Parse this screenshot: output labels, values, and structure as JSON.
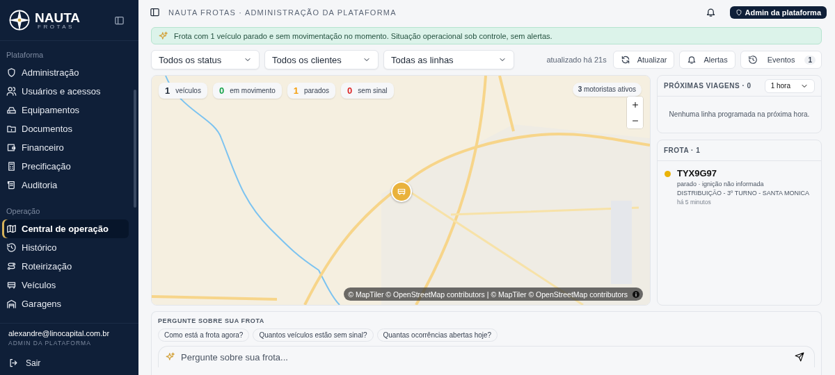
{
  "brand": {
    "name": "NAUTA",
    "sub": "FROTAS"
  },
  "sidebar": {
    "sections": [
      {
        "title": "Plataforma",
        "items": [
          {
            "label": "Administração",
            "selected": false
          },
          {
            "label": "Usuários e acessos",
            "selected": false
          },
          {
            "label": "Equipamentos",
            "selected": false
          },
          {
            "label": "Documentos",
            "selected": false
          },
          {
            "label": "Financeiro",
            "selected": false
          },
          {
            "label": "Precificação",
            "selected": false
          },
          {
            "label": "Auditoria",
            "selected": false
          }
        ]
      },
      {
        "title": "Operação",
        "items": [
          {
            "label": "Central de operação",
            "selected": true
          },
          {
            "label": "Histórico",
            "selected": false
          },
          {
            "label": "Roteirização",
            "selected": false
          },
          {
            "label": "Veículos",
            "selected": false
          },
          {
            "label": "Garagens",
            "selected": false
          }
        ]
      }
    ],
    "user": {
      "email": "alexandre@linocapital.com.br",
      "role": "ADMIN DA PLATAFORMA"
    },
    "logout": "Sair"
  },
  "header": {
    "title": "NAUTA FROTAS · ADMINISTRAÇÃO DA PLATAFORMA",
    "badge": "Admin da plataforma"
  },
  "banner": "Frota com 1 veículo parado e sem movimentação no momento. Situação operacional sob controle, sem alertas.",
  "filters": [
    "Todos os status",
    "Todos os clientes",
    "Todas as linhas"
  ],
  "updated": "atualizado há 21s",
  "actions": [
    {
      "label": "Atualizar"
    },
    {
      "label": "Alertas"
    },
    {
      "label": "Eventos",
      "count": "1"
    }
  ],
  "map": {
    "stats": [
      {
        "count": "1",
        "label": "veículos",
        "color": "#1f2937"
      },
      {
        "count": "0",
        "label": "em movimento",
        "color": "#16a34a"
      },
      {
        "count": "1",
        "label": "parados",
        "color": "#f59e0b"
      },
      {
        "count": "0",
        "label": "sem sinal",
        "color": "#dc2626"
      }
    ],
    "drivers": {
      "count": "3",
      "label": "motoristas ativos"
    },
    "attribution": "© MapTiler © OpenStreetMap contributors | © MapTiler © OpenStreetMap contributors"
  },
  "trips": {
    "title": "PRÓXIMAS VIAGENS · 0",
    "range": "1 hora",
    "empty": "Nenhuma linha programada na próxima hora."
  },
  "fleet": {
    "title": "FROTA · 1",
    "vehicles": [
      {
        "plate": "TYX9G97",
        "status": "parado · ignição não informada",
        "route": "DISTRIBUIÇÃO - 3º TURNO - SANTA MONICA",
        "time": "há 5 minutos",
        "color": "#eab308"
      }
    ]
  },
  "ask": {
    "title": "PERGUNTE SOBRE SUA FROTA",
    "suggestions": [
      "Como está a frota agora?",
      "Quantos veículos estão sem sinal?",
      "Quantas ocorrências abertas hoje?"
    ],
    "placeholder": "Pergunte sobre sua frota..."
  }
}
